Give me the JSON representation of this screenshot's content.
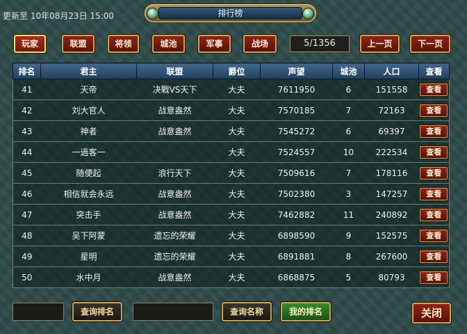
{
  "header": {
    "updated_text": "更新至 10年08月23日 15:00",
    "title": "排行榜"
  },
  "tabs": [
    "玩家",
    "联盟",
    "将领",
    "城池",
    "军事",
    "战场"
  ],
  "pagination": {
    "text": "5/1356",
    "prev_label": "上一页",
    "next_label": "下一页"
  },
  "table": {
    "columns": [
      "排名",
      "君主",
      "联盟",
      "爵位",
      "声望",
      "城池",
      "人口",
      "查看"
    ],
    "view_label": "查看",
    "rows": [
      {
        "rank": "41",
        "lord": "天帝",
        "alliance": "决戰VS天下",
        "title": "大夫",
        "prestige": "7611950",
        "cities": "6",
        "population": "151558"
      },
      {
        "rank": "42",
        "lord": "刘大官人",
        "alliance": "战意盎然",
        "title": "大夫",
        "prestige": "7570185",
        "cities": "7",
        "population": "72163"
      },
      {
        "rank": "43",
        "lord": "神者",
        "alliance": "战意盎然",
        "title": "大夫",
        "prestige": "7545272",
        "cities": "6",
        "population": "69397"
      },
      {
        "rank": "44",
        "lord": "一過客一",
        "alliance": "",
        "title": "大夫",
        "prestige": "7524557",
        "cities": "10",
        "population": "222534"
      },
      {
        "rank": "45",
        "lord": "随便起",
        "alliance": "浪行天下",
        "title": "大夫",
        "prestige": "7509616",
        "cities": "7",
        "population": "178116"
      },
      {
        "rank": "46",
        "lord": "相信就会永远",
        "alliance": "战意盎然",
        "title": "大夫",
        "prestige": "7502380",
        "cities": "3",
        "population": "147257"
      },
      {
        "rank": "47",
        "lord": "突击手",
        "alliance": "战意盎然",
        "title": "大夫",
        "prestige": "7462882",
        "cities": "11",
        "population": "240892"
      },
      {
        "rank": "48",
        "lord": "吴下阿蒙",
        "alliance": "遗忘的荣耀",
        "title": "大夫",
        "prestige": "6898590",
        "cities": "9",
        "population": "152575"
      },
      {
        "rank": "49",
        "lord": "星明",
        "alliance": "遗忘的荣耀",
        "title": "大夫",
        "prestige": "6891881",
        "cities": "8",
        "population": "267600"
      },
      {
        "rank": "50",
        "lord": "水中月",
        "alliance": "战意盎然",
        "title": "大夫",
        "prestige": "6868875",
        "cities": "5",
        "population": "80793"
      }
    ]
  },
  "footer": {
    "query_rank_input": "",
    "query_rank_label": "查询排名",
    "query_name_input": "",
    "query_name_label": "查询名称",
    "my_rank_label": "我的排名",
    "close_label": "关闭"
  },
  "colors": {
    "background": "#2e4a4a",
    "button_red": "#8e2416",
    "button_border_gold": "#c9a45a",
    "header_blue": "#44688a",
    "my_rank_green": "#3a8a2a"
  },
  "icons": [
    "title-knob-left-icon",
    "title-knob-right-icon"
  ]
}
